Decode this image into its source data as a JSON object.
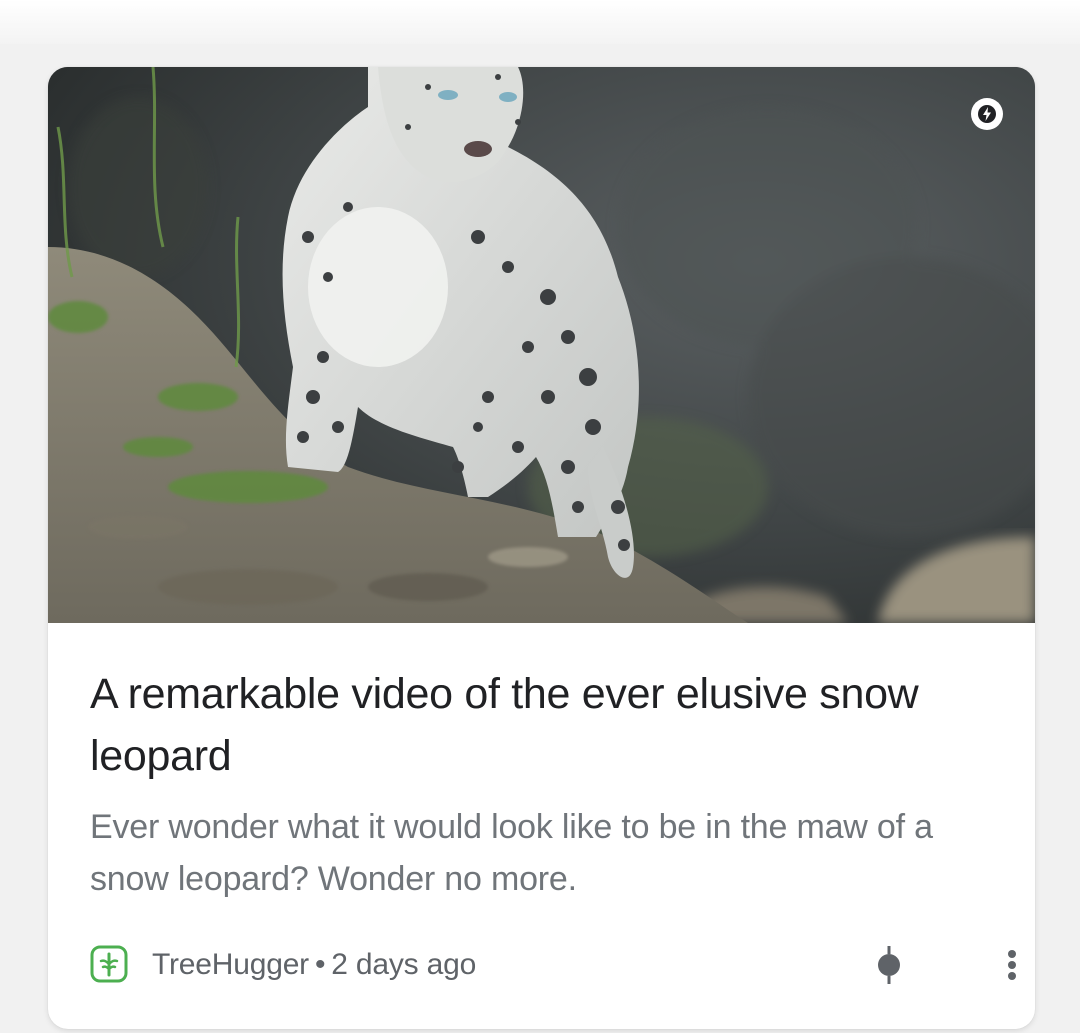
{
  "article": {
    "title": "A remarkable video of the ever elusive snow leopard",
    "snippet": "Ever wonder what it would look like to be in the maw of a snow leopard? Wonder no more.",
    "image_alt": "snow leopard photo",
    "amp_icon": "lightning-bolt-icon"
  },
  "source": {
    "name": "TreeHugger",
    "separator": "•",
    "time_ago": "2 days ago",
    "logo_icon": "treehugger-logo-icon",
    "logo_color": "#4caf50"
  },
  "actions": {
    "pin_icon": "pin-icon",
    "more_icon": "more-vert-icon"
  },
  "colors": {
    "title": "#202124",
    "snippet": "#70757a",
    "meta": "#5f6368"
  }
}
